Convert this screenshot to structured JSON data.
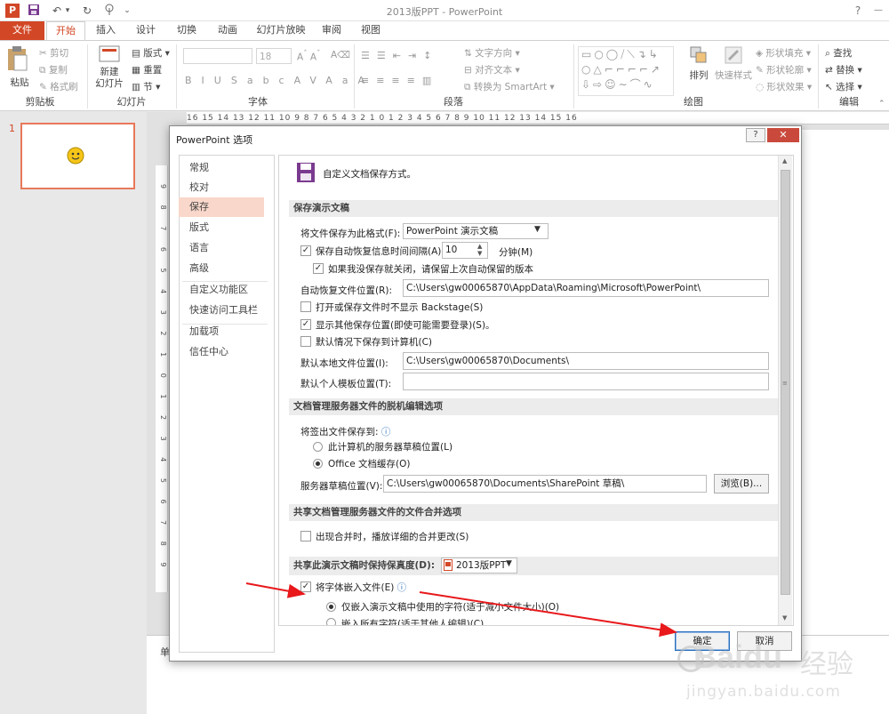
{
  "window": {
    "title": "2013版PPT - PowerPoint",
    "help": "?",
    "minimize": "—"
  },
  "qat": {
    "app_icon": "P",
    "save": "save-icon",
    "undo": "↶",
    "redo": "↻",
    "touch": "touch-mode-icon",
    "more": "⌄"
  },
  "tabs": [
    "文件",
    "开始",
    "插入",
    "设计",
    "切换",
    "动画",
    "幻灯片放映",
    "审阅",
    "视图"
  ],
  "ribbon": {
    "clipboard": {
      "label": "剪贴板",
      "paste": "粘贴",
      "cut": "剪切",
      "copy": "复制",
      "format_painter": "格式刷"
    },
    "slides": {
      "label": "幻灯片",
      "new_slide": "新建\n幻灯片",
      "layout": "版式",
      "reset": "重置",
      "section": "节"
    },
    "font": {
      "label": "字体",
      "size": "18"
    },
    "paragraph": {
      "label": "段落",
      "text_direction": "文字方向",
      "align_text": "对齐文本",
      "smartart": "转换为 SmartArt"
    },
    "drawing": {
      "label": "绘图",
      "arrange": "排列",
      "quick_styles": "快速样式",
      "shape_fill": "形状填充",
      "shape_outline": "形状轮廓",
      "shape_effects": "形状效果"
    },
    "editing": {
      "label": "编辑",
      "find": "查找",
      "replace": "替换",
      "select": "选择"
    }
  },
  "ruler_text": "16 15 14 13 12 11 10 9 8 7 6 5 4 3 2 1 0 1 2 3 4 5 6 7 8 9 10 11 12 13 14 15 16",
  "vruler_text": "9 8 7 6 5 4 3 2 1 0 1 2 3 4 5 6 7 8 9",
  "slide_number": "1",
  "status_fragment": "单",
  "dialog": {
    "title": "PowerPoint 选项",
    "nav": [
      "常规",
      "校对",
      "保存",
      "版式",
      "语言",
      "高级",
      "自定义功能区",
      "快速访问工具栏",
      "加载项",
      "信任中心"
    ],
    "header": "自定义文档保存方式。",
    "sections": {
      "save_presentation": "保存演示文稿",
      "offline_edit": "文档管理服务器文件的脱机编辑选项",
      "merge": "共享文档管理服务器文件的文件合并选项",
      "fidelity": "共享此演示文稿时保持保真度(D):"
    },
    "save_format_label": "将文件保存为此格式(F):",
    "save_format_value": "PowerPoint 演示文稿",
    "autorecover_label": "保存自动恢复信息时间间隔(A)",
    "autorecover_minutes": "10",
    "minutes_unit": "分钟(M)",
    "keep_last_autosaved": "如果我没保存就关闭，请保留上次自动保留的版本",
    "autorecover_location_label": "自动恢复文件位置(R):",
    "autorecover_location": "C:\\Users\\gw00065870\\AppData\\Roaming\\Microsoft\\PowerPoint\\",
    "no_backstage": "打开或保存文件时不显示 Backstage(S)",
    "show_other_locations": "显示其他保存位置(即使可能需要登录)(S)。",
    "save_to_computer": "默认情况下保存到计算机(C)",
    "default_local_label": "默认本地文件位置(I):",
    "default_local_value": "C:\\Users\\gw00065870\\Documents\\",
    "default_template_label": "默认个人模板位置(T):",
    "default_template_value": "",
    "checkout_label": "将签出文件保存到:",
    "radio_server_drafts": "此计算机的服务器草稿位置(L)",
    "radio_office_cache": "Office 文档缓存(O)",
    "server_drafts_label": "服务器草稿位置(V):",
    "server_drafts_value": "C:\\Users\\gw00065870\\Documents\\SharePoint 草稿\\",
    "browse": "浏览(B)...",
    "merge_detail": "出现合并时，播放详细的合并更改(S)",
    "fidelity_value": "2013版PPT",
    "embed_fonts": "将字体嵌入文件(E)",
    "embed_used_chars": "仅嵌入演示文稿中使用的字符(适于减小文件大小)(O)",
    "embed_all_chars": "嵌入所有字符(适于其他人编辑)(C)",
    "ok": "确定",
    "cancel": "取消",
    "checked": "✓"
  },
  "watermark": {
    "brand": "Baidu",
    "brand_cn": "经验",
    "url": "jingyan.baidu.com"
  },
  "colors": {
    "accent": "#d24726",
    "nav_selected": "#f9d7ca",
    "annotation": "#e8181b"
  }
}
